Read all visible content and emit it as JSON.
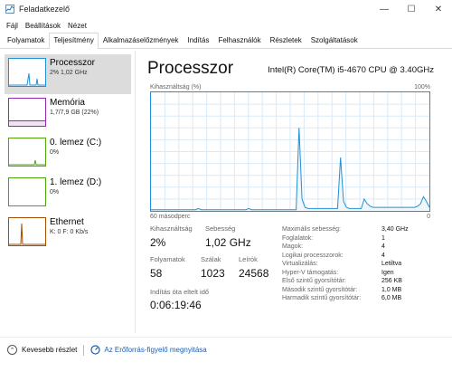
{
  "window": {
    "title": "Feladatkezelő",
    "minimize": "—",
    "maximize": "☐",
    "close": "✕"
  },
  "menu": [
    "Fájl",
    "Beállítások",
    "Nézet"
  ],
  "tabs": [
    "Folyamatok",
    "Teljesítmény",
    "Alkalmazáselőzmények",
    "Indítás",
    "Felhasználók",
    "Részletek",
    "Szolgáltatások"
  ],
  "active_tab": 1,
  "sidebar": [
    {
      "title": "Processzor",
      "sub": "2% 1,02 GHz",
      "color": "#1f91d8"
    },
    {
      "title": "Memória",
      "sub": "1,7/7,9 GB (22%)",
      "color": "#9528b4"
    },
    {
      "title": "0. lemez (C:)",
      "sub": "0%",
      "color": "#4da60c"
    },
    {
      "title": "1. lemez (D:)",
      "sub": "0%",
      "color": "#4da60c"
    },
    {
      "title": "Ethernet",
      "sub": "K: 0 F: 0 Kb/s",
      "color": "#a74f01"
    }
  ],
  "main": {
    "title": "Processzor",
    "cpu_name": "Intel(R) Core(TM) i5-4670 CPU @ 3.40GHz",
    "graph_label": "Kihasználtság (%)",
    "graph_max": "100%",
    "graph_time": "60 másodperc",
    "graph_min": "0"
  },
  "stats": {
    "util_label": "Kihasználtság",
    "util_value": "2%",
    "speed_label": "Sebesség",
    "speed_value": "1,02 GHz",
    "proc_label": "Folyamatok",
    "proc_value": "58",
    "threads_label": "Szálak",
    "threads_value": "1023",
    "handles_label": "Leírók",
    "handles_value": "24568",
    "uptime_label": "Indítás óta eltelt idő",
    "uptime_value": "0:06:19:46"
  },
  "properties": [
    {
      "name": "Maximális sebesség:",
      "value": "3,40 GHz"
    },
    {
      "name": "Foglalatok:",
      "value": "1"
    },
    {
      "name": "Magok:",
      "value": "4"
    },
    {
      "name": "Logikai processzorok:",
      "value": "4"
    },
    {
      "name": "Virtualizálás:",
      "value": "Letiltva"
    },
    {
      "name": "Hyper-V támogatás:",
      "value": "Igen"
    },
    {
      "name": "Első szintű gyorsítótár:",
      "value": "256 KB"
    },
    {
      "name": "Második szintű gyorsítótár:",
      "value": "1,0 MB"
    },
    {
      "name": "Harmadik szintű gyorsítótár:",
      "value": "6,0 MB"
    }
  ],
  "footer": {
    "fewer_details": "Kevesebb részlet",
    "resource_monitor": "Az Erőforrás-figyelő megnyitása"
  },
  "cpu_history": [
    1,
    1,
    1,
    1,
    1,
    1,
    1,
    1,
    1,
    1,
    1,
    1,
    1,
    1,
    1,
    1,
    2,
    1,
    1,
    1,
    1,
    1,
    1,
    1,
    1,
    1,
    1,
    1,
    1,
    1,
    1,
    1,
    1,
    2,
    1,
    1,
    1,
    1,
    1,
    1,
    1,
    1,
    1,
    1,
    1,
    1,
    1,
    1,
    1,
    1,
    70,
    10,
    3,
    2,
    2,
    2,
    2,
    2,
    2,
    2,
    2,
    2,
    2,
    2,
    45,
    8,
    3,
    2,
    2,
    2,
    2,
    2,
    10,
    6,
    4,
    3,
    3,
    3,
    3,
    3,
    3,
    3,
    3,
    3,
    3,
    3,
    3,
    3,
    3,
    3,
    4,
    6,
    12,
    8,
    3
  ]
}
